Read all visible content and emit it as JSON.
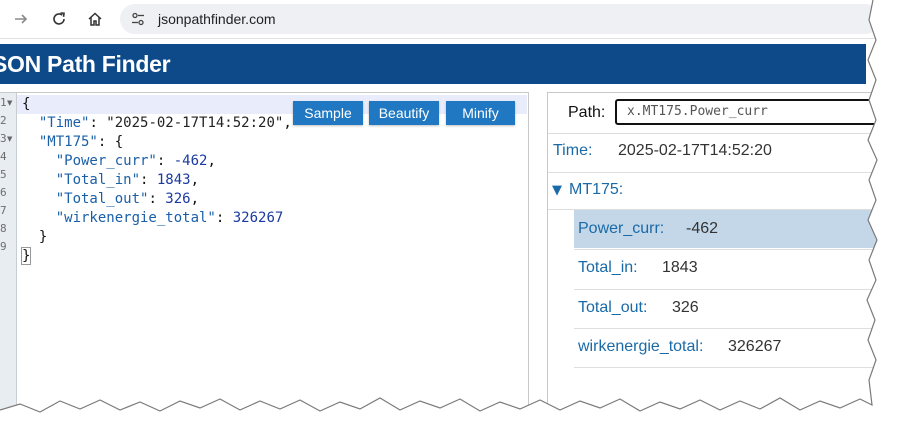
{
  "browser": {
    "url": "jsonpathfinder.com",
    "back_icon": "arrow-right-icon",
    "reload_icon": "reload-icon",
    "home_icon": "home-icon",
    "site_icon": "tune-icon"
  },
  "app": {
    "title": "SON Path Finder",
    "header_color": "#0e4a8a"
  },
  "editor": {
    "gutter_numbers": [
      "1",
      "2",
      "3",
      "4",
      "5",
      "6",
      "7",
      "8",
      "9"
    ],
    "buttons": {
      "sample": "Sample",
      "beautify": "Beautify",
      "minify": "Minify"
    },
    "lines": {
      "l1": "{",
      "l2_key": "\"Time\"",
      "l2_val": "\"2025-02-17T14:52:20\"",
      "l3_key": "\"MT175\"",
      "l3_rest": ": {",
      "l4_key": "\"Power_curr\"",
      "l4_val": "-462",
      "l5_key": "\"Total_in\"",
      "l5_val": "1843",
      "l6_key": "\"Total_out\"",
      "l6_val": "326",
      "l7_key": "\"wirkenergie_total\"",
      "l7_val": "326267",
      "l8": "}",
      "l9": "}"
    }
  },
  "tree": {
    "path_label": "Path:",
    "path_value": "x.MT175.Power_curr",
    "time_key": "Time:",
    "time_val": "2025-02-17T14:52:20",
    "mt_key": "MT175:",
    "mt_toggle": "▼",
    "items": [
      {
        "key": "Power_curr:",
        "val": "-462"
      },
      {
        "key": "Total_in:",
        "val": "1843"
      },
      {
        "key": "Total_out:",
        "val": "326"
      },
      {
        "key": "wirkenergie_total:",
        "val": "326267"
      }
    ]
  }
}
